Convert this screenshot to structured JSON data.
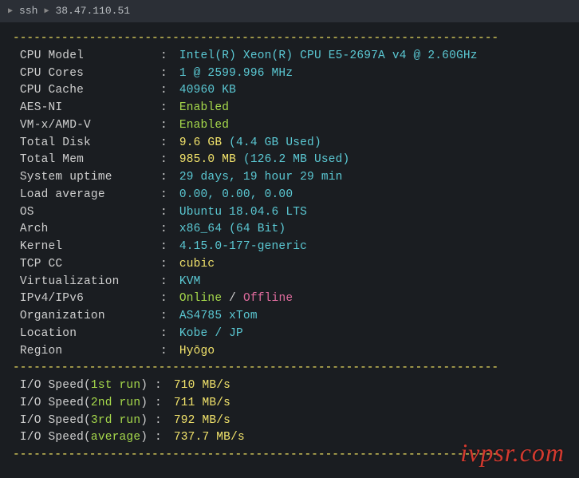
{
  "titlebar": {
    "prefix": "ssh",
    "host": "38.47.110.51"
  },
  "divider": "----------------------------------------------------------------------",
  "info": [
    {
      "label": "CPU Model",
      "parts": [
        {
          "t": "Intel(R) Xeon(R) CPU E5-2697A v4 @ 2.60GHz",
          "c": "val-cyan"
        }
      ]
    },
    {
      "label": "CPU Cores",
      "parts": [
        {
          "t": "1 @ 2599.996 MHz",
          "c": "val-cyan"
        }
      ]
    },
    {
      "label": "CPU Cache",
      "parts": [
        {
          "t": "40960 KB",
          "c": "val-cyan"
        }
      ]
    },
    {
      "label": "AES-NI",
      "parts": [
        {
          "t": "Enabled",
          "c": "val-green"
        }
      ]
    },
    {
      "label": "VM-x/AMD-V",
      "parts": [
        {
          "t": "Enabled",
          "c": "val-green"
        }
      ]
    },
    {
      "label": "Total Disk",
      "parts": [
        {
          "t": "9.6 GB ",
          "c": "val-yellow"
        },
        {
          "t": "(4.4 GB Used)",
          "c": "val-cyan"
        }
      ]
    },
    {
      "label": "Total Mem",
      "parts": [
        {
          "t": "985.0 MB ",
          "c": "val-yellow"
        },
        {
          "t": "(126.2 MB Used)",
          "c": "val-cyan"
        }
      ]
    },
    {
      "label": "System uptime",
      "parts": [
        {
          "t": "29 days, 19 hour 29 min",
          "c": "val-cyan"
        }
      ]
    },
    {
      "label": "Load average",
      "parts": [
        {
          "t": "0.00, 0.00, 0.00",
          "c": "val-cyan"
        }
      ]
    },
    {
      "label": "OS",
      "parts": [
        {
          "t": "Ubuntu 18.04.6 LTS",
          "c": "val-cyan"
        }
      ]
    },
    {
      "label": "Arch",
      "parts": [
        {
          "t": "x86_64 (64 Bit)",
          "c": "val-cyan"
        }
      ]
    },
    {
      "label": "Kernel",
      "parts": [
        {
          "t": "4.15.0-177-generic",
          "c": "val-cyan"
        }
      ]
    },
    {
      "label": "TCP CC",
      "parts": [
        {
          "t": "cubic",
          "c": "val-yellow"
        }
      ]
    },
    {
      "label": "Virtualization",
      "parts": [
        {
          "t": "KVM",
          "c": "val-cyan"
        }
      ]
    },
    {
      "label": "IPv4/IPv6",
      "parts": [
        {
          "t": "Online",
          "c": "val-green"
        },
        {
          "t": " / ",
          "c": "val-white"
        },
        {
          "t": "Offline",
          "c": "val-magenta"
        }
      ]
    },
    {
      "label": "Organization",
      "parts": [
        {
          "t": "AS4785 xTom",
          "c": "val-cyan"
        }
      ]
    },
    {
      "label": "Location",
      "parts": [
        {
          "t": "Kobe / JP",
          "c": "val-cyan"
        }
      ]
    },
    {
      "label": "Region",
      "parts": [
        {
          "t": "Hyōgo",
          "c": "val-yellow"
        }
      ]
    }
  ],
  "io": [
    {
      "which": "1st run",
      "value": "710 MB/s"
    },
    {
      "which": "2nd run",
      "value": "711 MB/s"
    },
    {
      "which": "3rd run",
      "value": "792 MB/s"
    },
    {
      "which": "average",
      "value": "737.7 MB/s"
    }
  ],
  "io_prefix": "I/O Speed(",
  "io_close": ")",
  "watermark": "ivpsr.com"
}
